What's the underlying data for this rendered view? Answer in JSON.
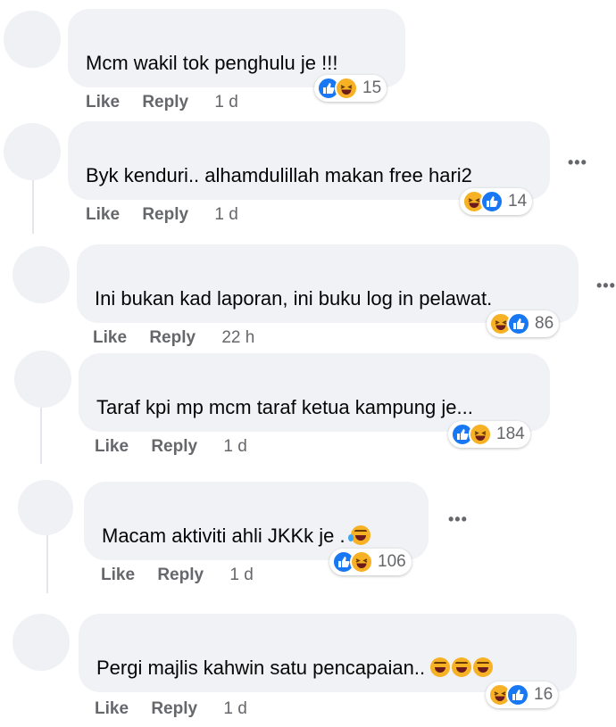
{
  "comments": [
    {
      "text": "Mcm wakil tok penghulu je !!!",
      "like": "Like",
      "reply": "Reply",
      "time": "1 d",
      "count": "15"
    },
    {
      "text": "Byk kenduri.. alhamdulillah makan free hari2",
      "like": "Like",
      "reply": "Reply",
      "time": "1 d",
      "count": "14"
    },
    {
      "text": "Ini bukan kad laporan, ini buku log in pelawat.",
      "like": "Like",
      "reply": "Reply",
      "time": "22 h",
      "count": "86"
    },
    {
      "text": "Taraf kpi mp mcm taraf ketua kampung je...",
      "like": "Like",
      "reply": "Reply",
      "time": "1 d",
      "count": "184"
    },
    {
      "text": "Macam aktiviti ahli JKKk je .",
      "like": "Like",
      "reply": "Reply",
      "time": "1 d",
      "count": "106"
    },
    {
      "text": "Pergi majlis kahwin satu pencapaian..",
      "like": "Like",
      "reply": "Reply",
      "time": "1 d",
      "count": "16"
    }
  ],
  "more_label": "•••",
  "icons": {
    "like": "thumbs-up-icon",
    "haha": "laughing-face-icon",
    "more": "more-options-icon"
  },
  "colors": {
    "bubble": "#f0f2f5",
    "meta": "#65676b",
    "like": "#1877f2",
    "haha": "#f7b125"
  }
}
